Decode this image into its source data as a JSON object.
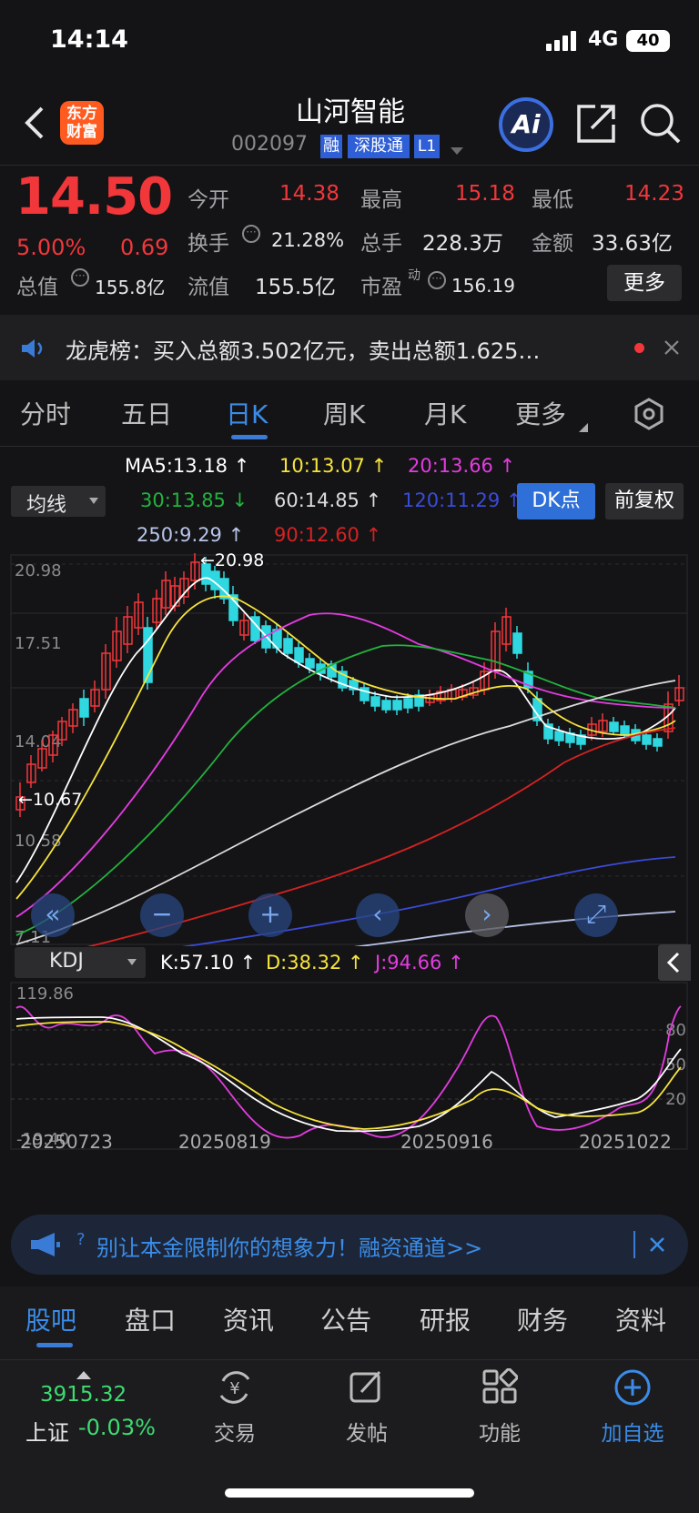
{
  "status": {
    "time": "14:14",
    "network": "4G",
    "battery": "40"
  },
  "header": {
    "logo_line1": "东方",
    "logo_line2": "财富",
    "title": "山河智能",
    "code": "002097",
    "badges": [
      "融",
      "深股通",
      "L1"
    ],
    "ai": "Ai"
  },
  "quote": {
    "price": "14.50",
    "pct": "5.00%",
    "chg": "0.69",
    "open_label": "今开",
    "open": "14.38",
    "high_label": "最高",
    "high": "15.18",
    "low_label": "最低",
    "low": "14.23",
    "turnover_label": "换手",
    "turnover": "21.28%",
    "vol_label": "总手",
    "vol": "228.3万",
    "amount_label": "金额",
    "amount": "33.63亿",
    "mcap_label": "总值",
    "mcap": "155.8亿",
    "float_label": "流值",
    "float": "155.5亿",
    "pe_label": "市盈",
    "pe_sup": "动",
    "pe": "156.19",
    "more": "更多"
  },
  "news": {
    "text": "龙虎榜：买入总额3.502亿元，卖出总额1.625…"
  },
  "tabs": [
    "分时",
    "五日",
    "日K",
    "周K",
    "月K",
    "更多"
  ],
  "active_tab": 2,
  "ma": {
    "selector": "均线",
    "ma5": "MA5:13.18",
    "ma10": "10:13.07",
    "ma20": "20:13.66",
    "ma30": "30:13.85",
    "ma60": "60:14.85",
    "ma120": "120:11.29",
    "ma250": "250:9.29",
    "ma90": "90:12.60",
    "dk": "DK点",
    "fq": "前复权"
  },
  "chart": {
    "y_labels": [
      "20.98",
      "17.51",
      "14.04",
      "10.58",
      "7.11"
    ],
    "max_label": "←20.98",
    "min_label": "←10.67"
  },
  "kdj": {
    "selector": "KDJ",
    "k": "K:57.10",
    "d": "D:38.32",
    "j": "J:94.66",
    "y_top": "119.86",
    "y_bottom": "-19.40",
    "levels": [
      "80",
      "50",
      "20"
    ],
    "dates": [
      "20250723",
      "20250819",
      "20250916",
      "20251022"
    ]
  },
  "banner": {
    "text": "别让本金限制你的想象力！融资通道>>"
  },
  "subtabs": [
    "股吧",
    "盘口",
    "资讯",
    "公告",
    "研报",
    "财务",
    "资料"
  ],
  "bottom": {
    "index_value": "3915.32",
    "index_name": "上证",
    "index_pct": "-0.03%",
    "nav": [
      "交易",
      "发帖",
      "功能",
      "加自选"
    ]
  },
  "colors": {
    "up": "#f2373b",
    "down": "#3ddc71",
    "accent": "#3a7bd5",
    "ma5": "#ffffff",
    "ma10": "#f7e43c",
    "ma20": "#e33ce0",
    "ma30": "#22b33d",
    "ma60": "#dcdcdc",
    "ma120": "#3a4bd8",
    "ma250": "#b7c4e8",
    "ma90": "#d42222"
  }
}
